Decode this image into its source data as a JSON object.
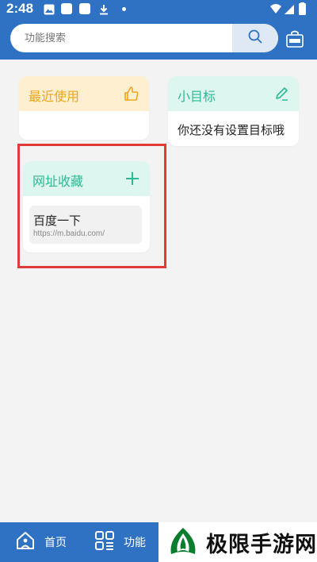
{
  "status_bar": {
    "time": "2:48"
  },
  "search": {
    "placeholder": "功能搜索"
  },
  "cards": {
    "recent": {
      "title": "最近使用"
    },
    "goal": {
      "title": "小目标",
      "empty_text": "你还没有设置目标哦"
    },
    "favorites": {
      "title": "网址收藏",
      "items": [
        {
          "title": "百度一下",
          "url": "https://m.baidu.com/"
        }
      ]
    }
  },
  "tabbar": {
    "home_label": "首页",
    "features_label": "功能"
  },
  "watermark": {
    "text": "极限手游网"
  },
  "colors": {
    "primary": "#2f72c4",
    "recent_header": "#fdefd0",
    "recent_accent": "#f0a51a",
    "green_header": "#ddf6ef",
    "green_accent": "#30b896",
    "highlight": "#e03a3a"
  },
  "icons": {
    "search": "search-icon",
    "new": "new-badge-icon",
    "thumbs_up": "thumbs-up-icon",
    "edit": "pencil-icon",
    "add": "plus-icon",
    "home": "home-icon",
    "features": "grid-icon"
  }
}
